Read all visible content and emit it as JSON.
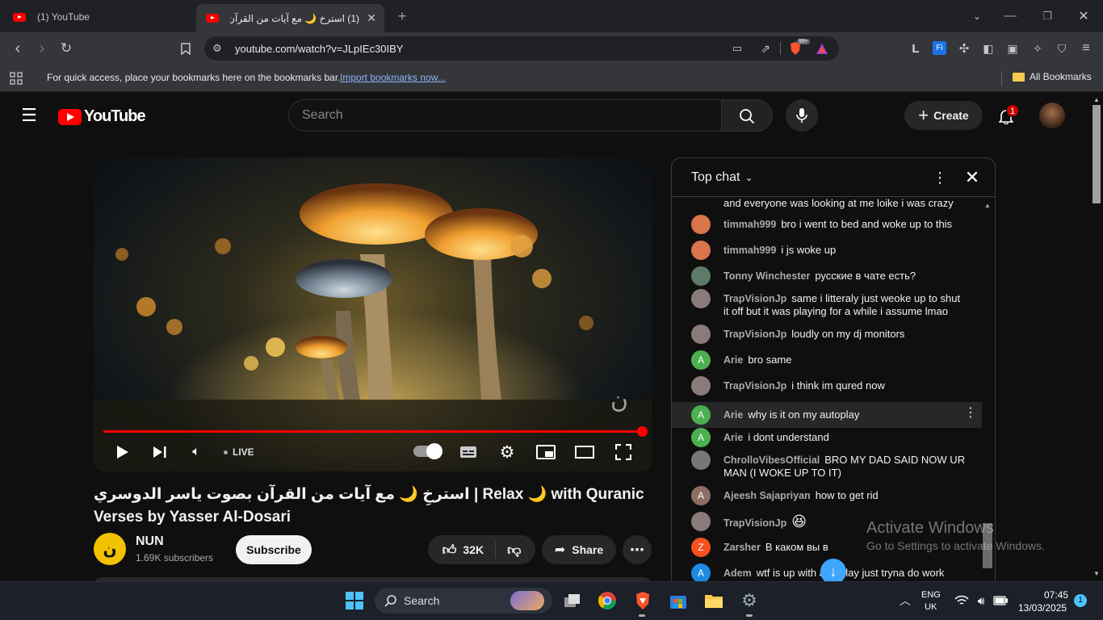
{
  "browser": {
    "tabs": [
      {
        "title": "(1) YouTube"
      },
      {
        "title": "(1) استرخِ 🌙 مع آيات من القرآن"
      }
    ],
    "url": "youtube.com/watch?v=JLpIEc30IBY",
    "bookmarks_prompt": "For quick access, place your bookmarks here on the bookmarks bar.",
    "import_link": "Import bookmarks now...",
    "all_bookmarks": "All Bookmarks",
    "brave_badge": "99+"
  },
  "youtube": {
    "logo_text": "YouTube",
    "search_placeholder": "Search",
    "create_label": "Create",
    "notification_count": "1",
    "video": {
      "live_label": "LIVE",
      "title": "استرخِ 🌙 مع آيات من القرآن بصوت ياسر الدوسري | Relax 🌙 with Quranic Verses by Yasser Al-Dosari",
      "channel": "NUN",
      "subscribers": "1.69K subscribers",
      "subscribe_label": "Subscribe",
      "likes": "32K",
      "share_label": "Share",
      "progress": 1.0
    },
    "chat": {
      "header": "Top chat",
      "messages": [
        {
          "author": "",
          "text": "and everyone was looking at me loike i was crazy",
          "color": ""
        },
        {
          "author": "timmah999",
          "text": "bro i went to bed and woke up to this",
          "color": "#d9744b"
        },
        {
          "author": "timmah999",
          "text": "i js woke up",
          "color": "#d9744b"
        },
        {
          "author": "Tonny Winchester",
          "text": "русские в чате есть?",
          "color": "#5e7b6a"
        },
        {
          "author": "TrapVisionJp",
          "text": "same i litteraly just weoke up to shut it off but it was playing for a while i assume lmao",
          "color": "#8a7b7b"
        },
        {
          "author": "TrapVisionJp",
          "text": "loudly on my dj monitors",
          "color": "#8a7b7b"
        },
        {
          "author": "Arie",
          "text": "bro same",
          "color": "#4caf50",
          "initial": "A"
        },
        {
          "author": "TrapVisionJp",
          "text": "i think im qured now",
          "color": "#8a7b7b"
        },
        {
          "author": "Arie",
          "text": "why is it on my autoplay",
          "color": "#4caf50",
          "initial": "A"
        },
        {
          "author": "Arie",
          "text": "i dont understand",
          "color": "#4caf50",
          "initial": "A"
        },
        {
          "author": "ChrolloVibesOfficial",
          "text": "BRO MY DAD SAID NOW UR MAN (I WOKE UP TO IT)",
          "color": "#777"
        },
        {
          "author": "Ajeesh Sajapriyan",
          "text": "how to get rid",
          "color": "#8d6e63",
          "initial": "A"
        },
        {
          "author": "TrapVisionJp",
          "text": "😆",
          "color": "#8a7b7b"
        },
        {
          "author": "Zarsher",
          "text": "В каком вы в",
          "color": "#f4511e",
          "initial": "Z"
        },
        {
          "author": "Adem",
          "text": "wtf is up with autoplay just tryna do work",
          "color": "#1e88e5",
          "initial": "A"
        }
      ]
    }
  },
  "windows": {
    "activate_title": "Activate Windows",
    "activate_sub": "Go to Settings to activate Windows.",
    "search_label": "Search",
    "lang_top": "ENG",
    "lang_bottom": "UK",
    "time": "07:45",
    "date": "13/03/2025",
    "notif": "1"
  }
}
